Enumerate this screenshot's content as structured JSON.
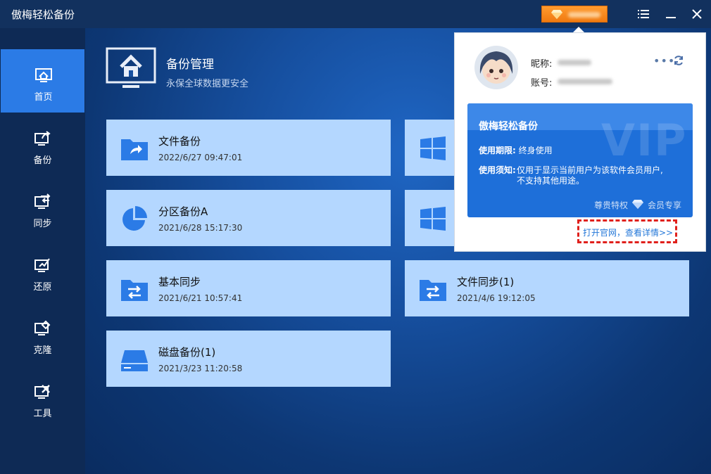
{
  "app": {
    "title": "傲梅轻松备份"
  },
  "titlebar": {
    "menu_icon": "list-icon",
    "minimize_icon": "minimize-icon",
    "close_icon": "close-icon"
  },
  "sidebar": {
    "items": [
      {
        "label": "首页",
        "icon": "home-icon",
        "active": true
      },
      {
        "label": "备份",
        "icon": "backup-icon",
        "active": false
      },
      {
        "label": "同步",
        "icon": "sync-icon",
        "active": false
      },
      {
        "label": "还原",
        "icon": "restore-icon",
        "active": false
      },
      {
        "label": "克隆",
        "icon": "clone-icon",
        "active": false
      },
      {
        "label": "工具",
        "icon": "tools-icon",
        "active": false
      }
    ]
  },
  "header": {
    "title": "备份管理",
    "subtitle": "永保全球数据更安全"
  },
  "tasks": [
    {
      "title": "文件备份",
      "time": "2022/6/27 09:47:01",
      "icon": "folder-share-icon"
    },
    {
      "title": "分区备份A",
      "time": "2021/6/28 15:17:30",
      "icon": "pie-chart-icon"
    },
    {
      "title": "基本同步",
      "time": "2021/6/21 10:57:41",
      "icon": "folder-sync-icon"
    },
    {
      "title": "文件同步(1)",
      "time": "2021/4/6 19:12:05",
      "icon": "folder-sync-icon"
    },
    {
      "title": "磁盘备份(1)",
      "time": "2021/3/23 11:20:58",
      "icon": "disk-icon"
    }
  ],
  "account": {
    "nickname_label": "昵称:",
    "account_label": "账号:",
    "more_icon": "more-icon",
    "refresh_icon": "refresh-icon",
    "vip": {
      "name": "傲梅轻松备份",
      "watermark": "VIP",
      "period_label": "使用期限:",
      "period_value": "终身使用",
      "notice_label": "使用须知:",
      "notice_value": "仅用于显示当前用户为该软件会员用户,不支持其他用途。",
      "privilege": "尊贵特权",
      "exclusive": "会员专享"
    },
    "detail_link": "打开官网，查看详情>>"
  },
  "colors": {
    "accent": "#2b7be6",
    "card": "#b4d7ff",
    "upgrade": "#f5871f",
    "highlight": "#e0201c"
  }
}
